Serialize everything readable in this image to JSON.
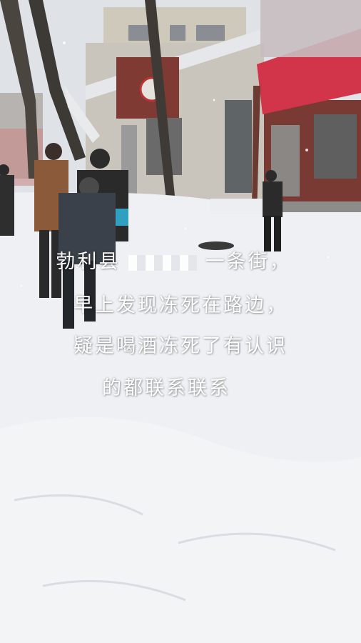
{
  "caption": {
    "line1_prefix": "勃利县",
    "line1_suffix": "一条街，",
    "line2": "早上发现冻死在路边，",
    "line3": "疑是喝酒冻死了有认识",
    "line4": "的都联系联系"
  },
  "colors": {
    "snow": "#eef0f3",
    "sky": "#dfe3e8",
    "awning": "#d2354a",
    "brick": "#7a3a34"
  }
}
